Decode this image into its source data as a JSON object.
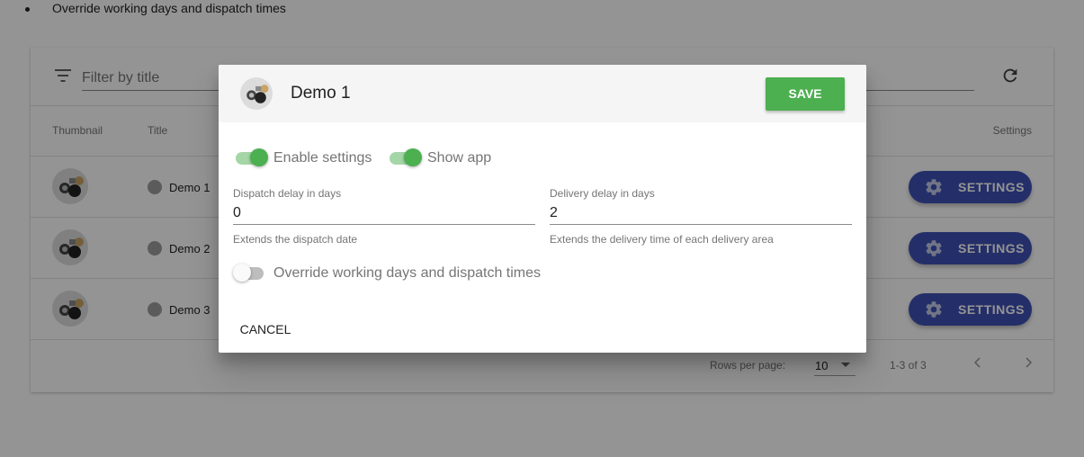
{
  "background": {
    "bullet_text": "Override working days and dispatch times",
    "filter_placeholder": "Filter by title",
    "columns": {
      "thumbnail": "Thumbnail",
      "title": "Title",
      "settings": "Settings"
    },
    "rows": [
      {
        "title": "Demo 1",
        "button": "SETTINGS"
      },
      {
        "title": "Demo 2",
        "button": "SETTINGS"
      },
      {
        "title": "Demo 3",
        "button": "SETTINGS"
      }
    ],
    "footer": {
      "rows_per_page_label": "Rows per page:",
      "rows_per_page_value": "10",
      "range": "1-3 of 3"
    }
  },
  "dialog": {
    "title": "Demo 1",
    "save_label": "SAVE",
    "enable_settings": {
      "label": "Enable settings",
      "checked": true
    },
    "show_app": {
      "label": "Show app",
      "checked": true
    },
    "dispatch_delay": {
      "label": "Dispatch delay in days",
      "value": "0",
      "help": "Extends the dispatch date"
    },
    "delivery_delay": {
      "label": "Delivery delay in days",
      "value": "2",
      "help": "Extends the delivery time of each delivery area"
    },
    "override": {
      "label": "Override working days and dispatch times",
      "checked": false
    },
    "cancel_label": "CANCEL"
  },
  "colors": {
    "primary": "#3f51b5",
    "success": "#4caf50",
    "switch_track_on": "#a5d6a7"
  }
}
